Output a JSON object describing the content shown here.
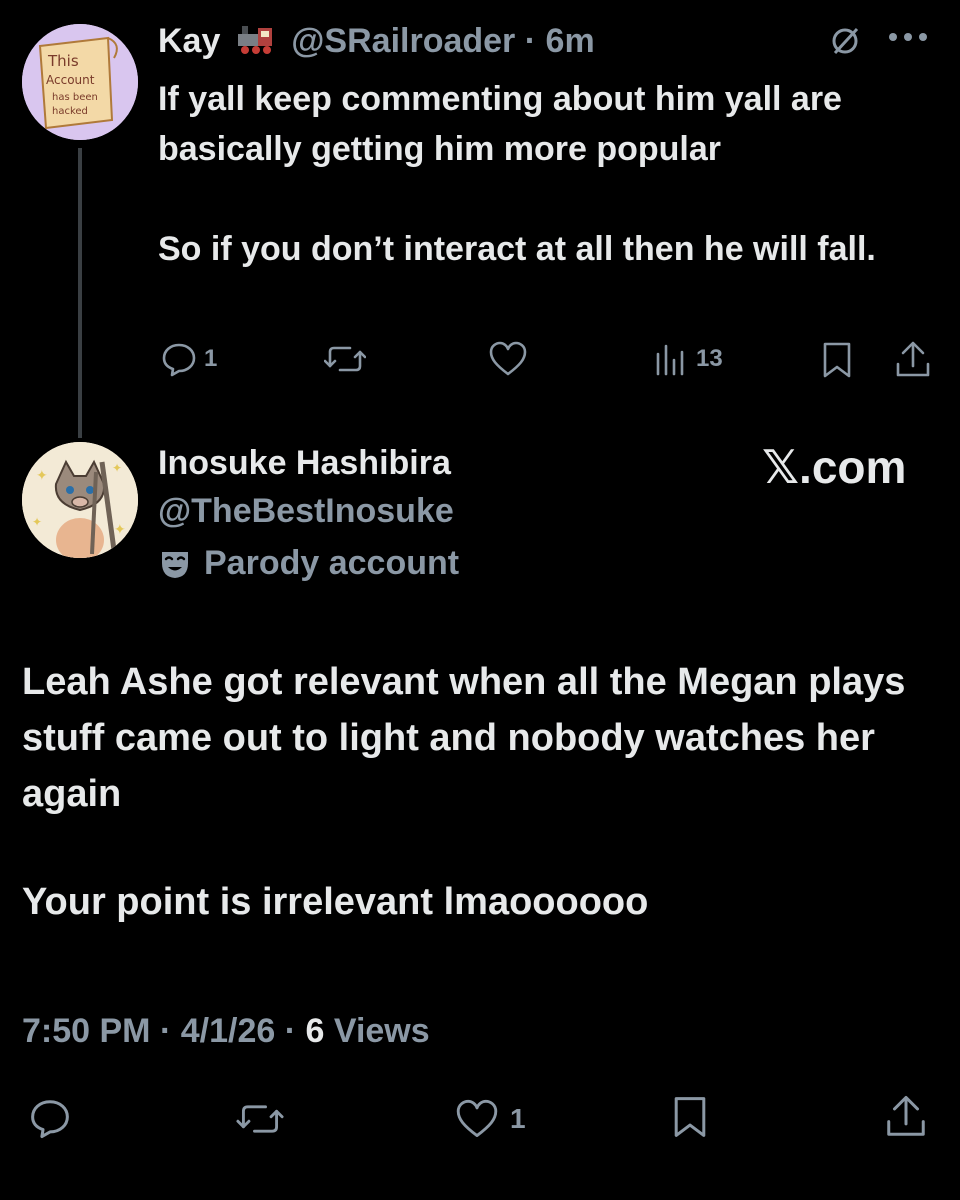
{
  "reply": {
    "avatar_text": [
      "This",
      "Account",
      "has been",
      "hacked"
    ],
    "display_name": "Kay",
    "name_emoji": "train-icon",
    "handle": "@SRailroader",
    "separator": "·",
    "time_ago": "6m",
    "paragraphs": [
      "If yall keep commenting about him yall are basically getting him more popular",
      "So if you don’t interact at all then he will fall."
    ],
    "actions": {
      "replies": "1",
      "retweets": "",
      "likes": "",
      "views": "13"
    }
  },
  "main": {
    "display_name": "Inosuke Hashibira",
    "handle": "@TheBestInosuke",
    "badge_label": "Parody account",
    "watermark": "𝕏.com",
    "paragraphs": [
      "Leah Ashe got relevant when all the Megan plays stuff came out to light and nobody watches her again",
      "Your point is irrelevant lmaoooooo"
    ],
    "time": "7:50 PM",
    "date": "4/1/26",
    "separator": "·",
    "views_count": "6",
    "views_label": "Views",
    "actions": {
      "replies": "",
      "retweets": "",
      "likes": "1"
    }
  },
  "colors": {
    "background": "#000000",
    "text_primary": "#e7e9ea",
    "text_secondary": "#8b98a5",
    "thread_line": "#3a3f43"
  }
}
